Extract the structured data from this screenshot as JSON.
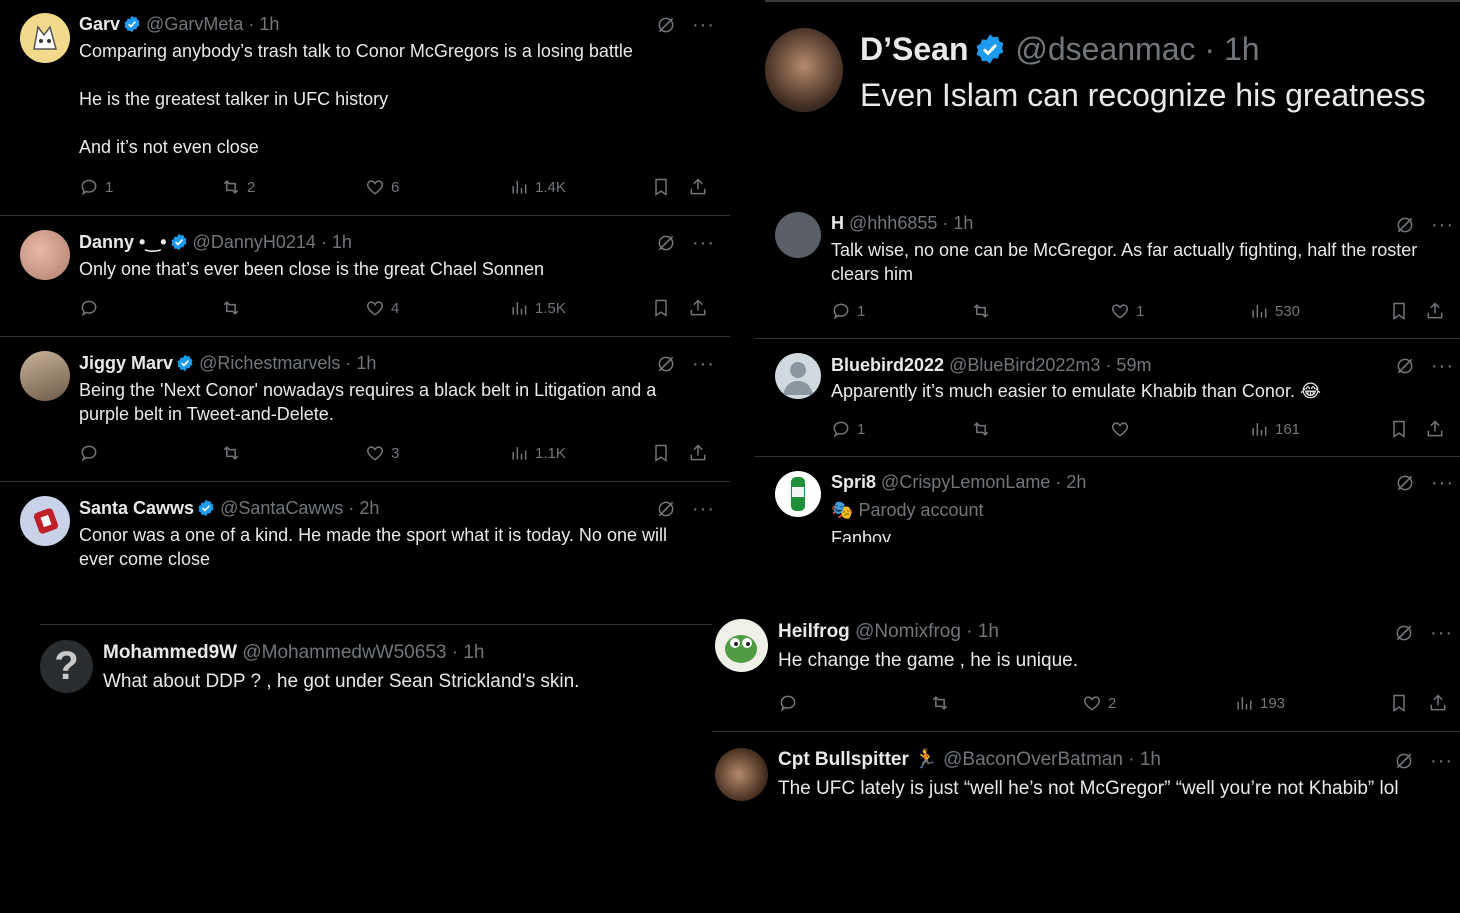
{
  "colors": {
    "background": "#000000",
    "text": "#e7e9ea",
    "muted": "#71767b",
    "verified": "#1d9bf0",
    "divider": "#2f3336"
  },
  "icons": {
    "reply": "reply-icon",
    "repost": "repost-icon",
    "like": "heart-icon",
    "views": "views-icon",
    "bookmark": "bookmark-icon",
    "share": "share-icon",
    "grok": "grok-icon",
    "more": "more-icon",
    "verified": "verified-badge-icon"
  },
  "left_panel": [
    {
      "name": "Garv",
      "handle": "@GarvMeta",
      "time": "· 1h",
      "lines": [
        "Comparing anybody’s trash talk to Conor McGregors is a losing battle",
        "",
        "He is the greatest talker in UFC history",
        "",
        "And it’s not even close"
      ],
      "reply": "1",
      "repost": "2",
      "like": "6",
      "views": "1.4K"
    },
    {
      "name": "Danny •‿•",
      "handle": "@DannyH0214",
      "time": "· 1h",
      "lines": [
        "Only one that’s ever been close is the great Chael Sonnen"
      ],
      "reply": "",
      "repost": "",
      "like": "4",
      "views": "1.5K"
    },
    {
      "name": "Jiggy Marv",
      "handle": "@Richestmarvels",
      "time": "· 1h",
      "lines": [
        "Being the 'Next Conor' nowadays requires a black belt in Litigation and a",
        "purple belt in Tweet-and-Delete."
      ],
      "reply": "",
      "repost": "",
      "like": "3",
      "views": "1.1K"
    },
    {
      "name": "Santa Cawws",
      "handle": "@SantaCawws",
      "time": "· 2h",
      "lines": [
        "Conor was a one of a kind. He made the sport what it is today. No one will",
        "ever come close"
      ]
    }
  ],
  "main_tweet": {
    "name": "D’Sean",
    "handle": "@dseanmac",
    "time": "· 1h",
    "text": "Even Islam can recognize his greatness"
  },
  "right_panel": [
    {
      "name": "H",
      "handle": "@hhh6855",
      "time": "· 1h",
      "lines": [
        "Talk wise, no one can be McGregor. As far actually fighting, half the roster",
        "clears him"
      ],
      "reply": "1",
      "repost": "",
      "like": "1",
      "views": "530"
    },
    {
      "name": "Bluebird2022",
      "handle": "@BlueBird2022m3",
      "time": "· 59m",
      "lines": [
        "Apparently it’s much easier to emulate Khabib than Conor. 😂"
      ],
      "reply": "1",
      "repost": "",
      "like": "",
      "views": "161"
    },
    {
      "name": "Spri8",
      "handle": "@CrispyLemonLame",
      "time": "· 2h",
      "lines": [
        "Parody account",
        "Fanboy"
      ]
    }
  ],
  "bottom_left": {
    "name": "Mohammed9W",
    "handle": "@MohammedwW50653",
    "time": "· 1h",
    "text": "What about DDP ? , he got under Sean Strickland's skin."
  },
  "bottom_right": [
    {
      "name": "Heilfrog",
      "handle": "@Nomixfrog",
      "time": "· 1h",
      "text": "He change the game , he is unique.",
      "reply": "",
      "repost": "",
      "like": "2",
      "views": "193"
    },
    {
      "name": "Cpt Bullspitter",
      "handle": "@BaconOverBatman",
      "time": "· 1h",
      "text": "The UFC lately is just “well he’s not McGregor” “well you’re not Khabib” lol"
    }
  ]
}
